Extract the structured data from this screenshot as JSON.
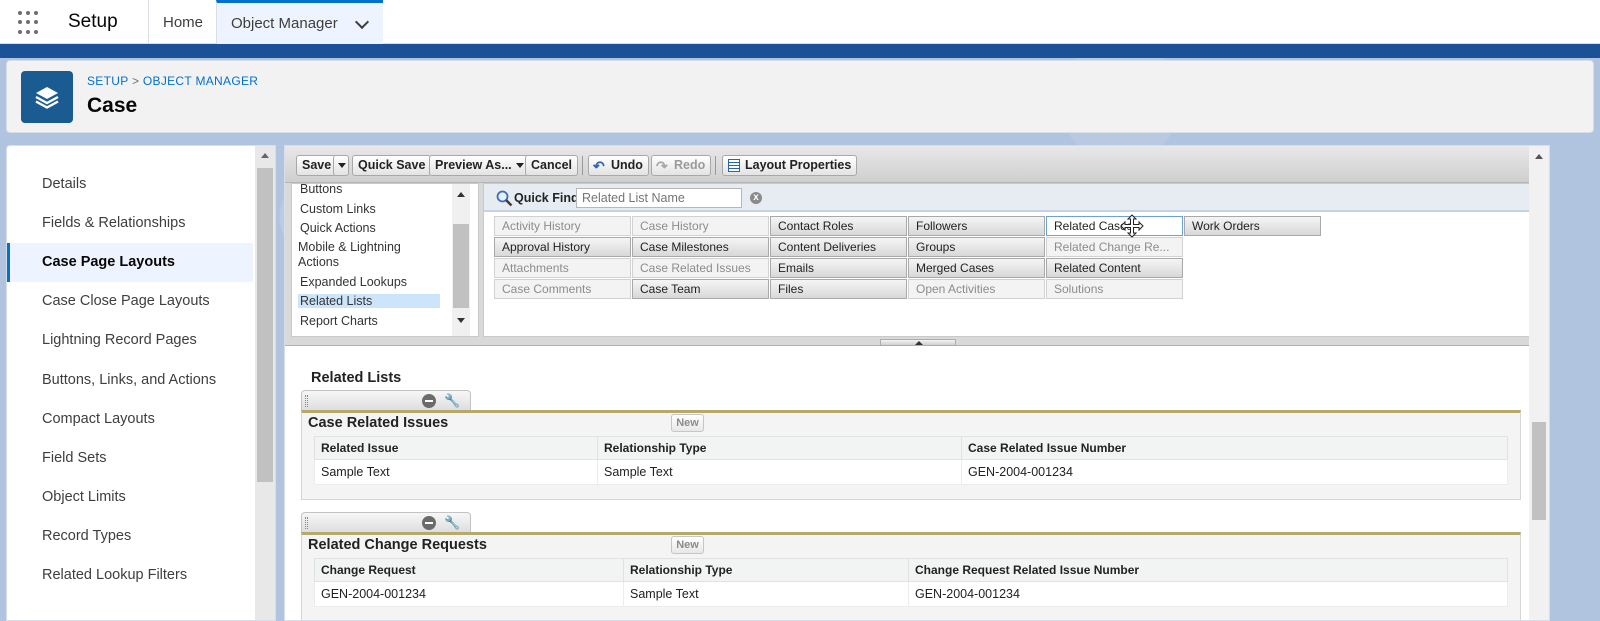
{
  "topbar": {
    "app_name": "Setup",
    "tabs": [
      {
        "label": "Home"
      },
      {
        "label": "Object Manager"
      }
    ]
  },
  "header": {
    "breadcrumb": [
      "SETUP",
      "OBJECT MANAGER"
    ],
    "breadcrumb_sep": ">",
    "title": "Case"
  },
  "leftnav": {
    "items": [
      {
        "label": "Details"
      },
      {
        "label": "Fields & Relationships"
      },
      {
        "label": "Case Page Layouts"
      },
      {
        "label": "Case Close Page Layouts"
      },
      {
        "label": "Lightning Record Pages"
      },
      {
        "label": "Buttons, Links, and Actions"
      },
      {
        "label": "Compact Layouts"
      },
      {
        "label": "Field Sets"
      },
      {
        "label": "Object Limits"
      },
      {
        "label": "Record Types"
      },
      {
        "label": "Related Lookup Filters"
      }
    ],
    "active": "Case Page Layouts"
  },
  "toolbar": {
    "save": "Save",
    "quick_save": "Quick Save",
    "preview_as": "Preview As...",
    "cancel": "Cancel",
    "undo": "Undo",
    "redo": "Redo",
    "layout_properties": "Layout Properties"
  },
  "palette": {
    "categories": [
      "Buttons",
      "Custom Links",
      "Quick Actions",
      "Mobile & Lightning",
      "Actions",
      "Expanded Lookups",
      "Related Lists",
      "Report Charts"
    ],
    "selected_category": "Related Lists",
    "quick_find_label": "Quick Find",
    "quick_find_placeholder": "Related List Name",
    "quick_find_clear": "x",
    "items": [
      [
        {
          "label": "Activity History",
          "state": "off"
        },
        {
          "label": "Approval History",
          "state": "on"
        },
        {
          "label": "Attachments",
          "state": "off"
        },
        {
          "label": "Case Comments",
          "state": "off"
        }
      ],
      [
        {
          "label": "Case History",
          "state": "off"
        },
        {
          "label": "Case Milestones",
          "state": "on"
        },
        {
          "label": "Case Related Issues",
          "state": "off"
        },
        {
          "label": "Case Team",
          "state": "on"
        }
      ],
      [
        {
          "label": "Contact Roles",
          "state": "on"
        },
        {
          "label": "Content Deliveries",
          "state": "on"
        },
        {
          "label": "Emails",
          "state": "on"
        },
        {
          "label": "Files",
          "state": "on"
        }
      ],
      [
        {
          "label": "Followers",
          "state": "on"
        },
        {
          "label": "Groups",
          "state": "on"
        },
        {
          "label": "Merged Cases",
          "state": "on"
        },
        {
          "label": "Open Activities",
          "state": "off"
        }
      ],
      [
        {
          "label": "Related Cases",
          "state": "focus"
        },
        {
          "label": "Related Change Re...",
          "state": "off"
        },
        {
          "label": "Related Content",
          "state": "on"
        },
        {
          "label": "Solutions",
          "state": "off"
        }
      ],
      [
        {
          "label": "Work Orders",
          "state": "on"
        }
      ]
    ]
  },
  "canvas": {
    "section_title": "Related Lists",
    "related_lists": [
      {
        "title": "Case Related Issues",
        "new_label": "New",
        "columns": [
          "Related Issue",
          "Relationship Type",
          "Case Related Issue Number"
        ],
        "row": [
          "Sample Text",
          "Sample Text",
          "GEN-2004-001234"
        ]
      },
      {
        "title": "Related Change Requests",
        "new_label": "New",
        "columns": [
          "Change Request",
          "Relationship Type",
          "Change Request Related Issue Number"
        ],
        "row": [
          "GEN-2004-001234",
          "Sample Text",
          "GEN-2004-001234"
        ]
      }
    ]
  },
  "colors": {
    "brand_blue": "#0070d2",
    "header_stripe": "#1b5297",
    "object_icon": "#1a5c91",
    "related_list_accent": "#b7a96b"
  }
}
